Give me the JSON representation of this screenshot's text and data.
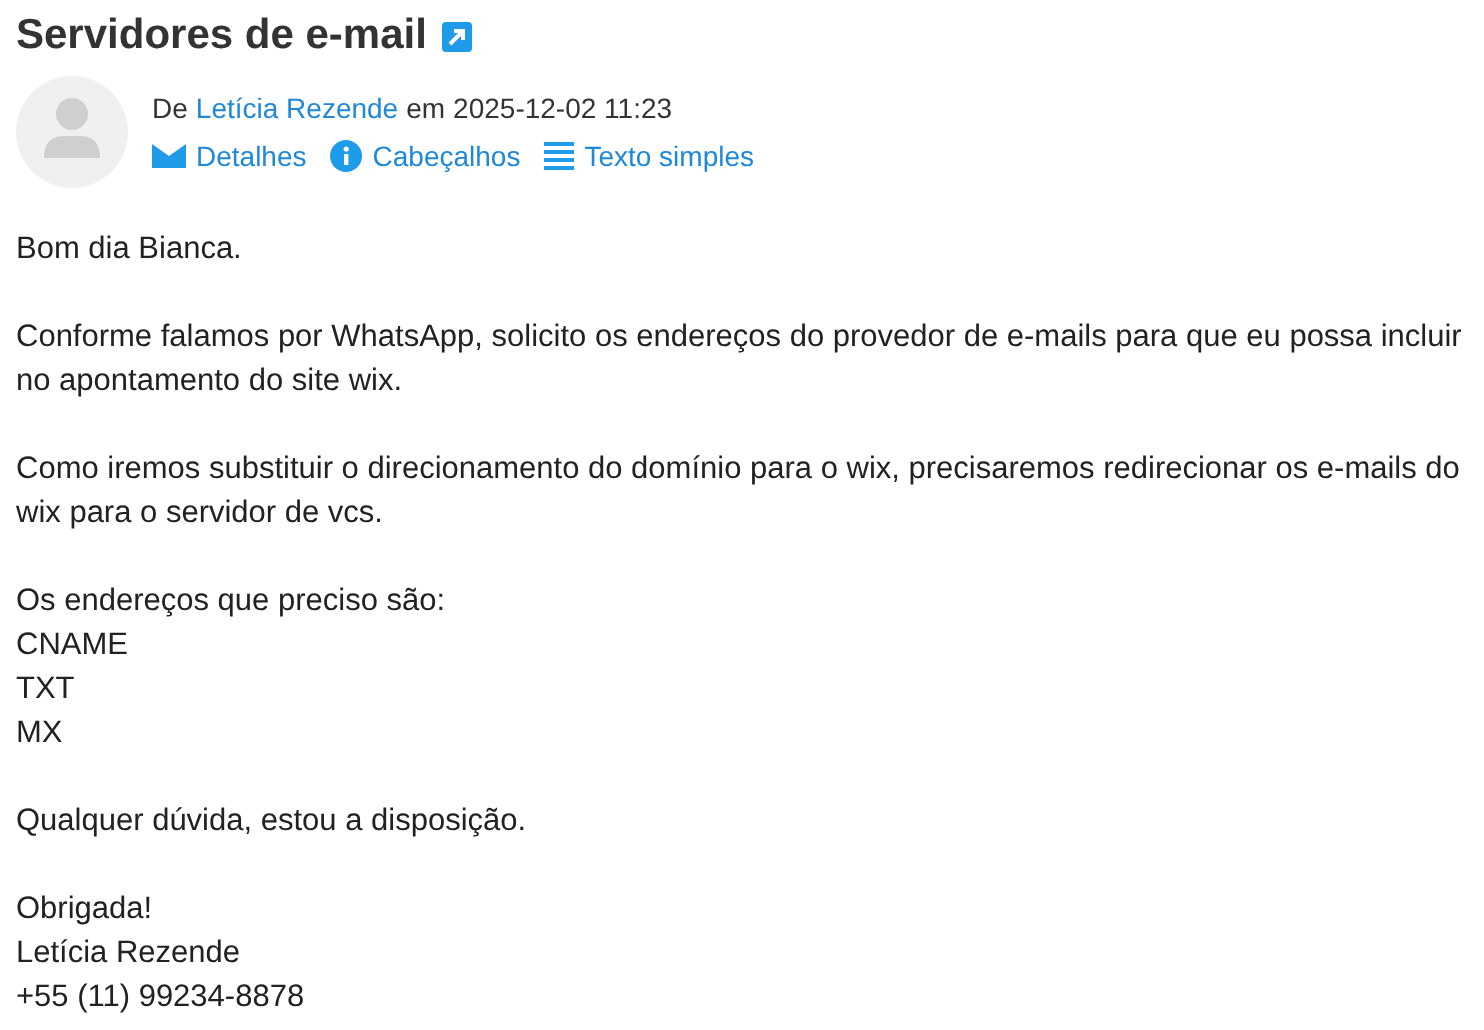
{
  "subject": "Servidores de e-mail",
  "from": {
    "prefix": "De",
    "sender": "Letícia Rezende",
    "date_prefix": "em",
    "date": "2025-12-02 11:23"
  },
  "actions": [
    {
      "kind": "envelope",
      "label": "Detalhes"
    },
    {
      "kind": "info",
      "label": "Cabeçalhos"
    },
    {
      "kind": "lines",
      "label": "Texto simples"
    }
  ],
  "body": [
    [
      "Bom dia Bianca."
    ],
    [
      "Conforme falamos por WhatsApp, solicito os endereços do provedor de e-mails para que eu possa incluir no apontamento do site wix."
    ],
    [
      "Como iremos substituir o direcionamento do domínio para o wix, precisaremos redirecionar os e-mails do wix para o servidor de vcs."
    ],
    [
      "Os endereços que preciso são:",
      "CNAME",
      "TXT",
      "MX"
    ],
    [
      "Qualquer dúvida, estou a disposição."
    ],
    [
      "Obrigada!",
      "Letícia Rezende",
      "+55 (11) 99234-8878"
    ]
  ]
}
